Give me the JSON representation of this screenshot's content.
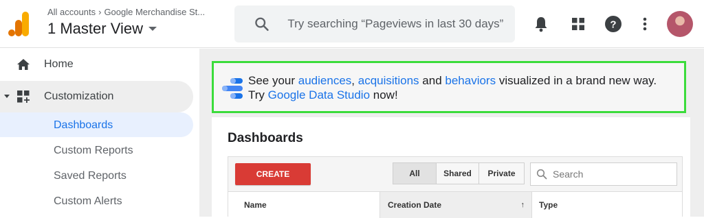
{
  "header": {
    "breadcrumb_root": "All accounts",
    "breadcrumb_property": "Google Merchandise St...",
    "view_name": "1 Master View",
    "search_placeholder": "Try searching “Pageviews in last 30 days”"
  },
  "sidebar": {
    "home_label": "Home",
    "customization_label": "Customization",
    "sub_items": [
      "Dashboards",
      "Custom Reports",
      "Saved Reports",
      "Custom Alerts"
    ],
    "active_item": "Dashboards"
  },
  "banner": {
    "prefix": "See your ",
    "link_audiences": "audiences",
    "sep1": ", ",
    "link_acquisitions": "acquisitions",
    "sep2": " and ",
    "link_behaviors": "behaviors",
    "middle": " visualized in a brand new way. Try ",
    "link_studio": "Google Data Studio",
    "suffix": " now!"
  },
  "dashboards": {
    "title": "Dashboards",
    "create_label": "CREATE",
    "filters": [
      "All",
      "Shared",
      "Private"
    ],
    "active_filter": "All",
    "search_placeholder": "Search",
    "columns": [
      "Name",
      "Creation Date",
      "Type"
    ],
    "sort_indicator": "↑"
  },
  "colors": {
    "accent": "#1a73e8",
    "create_button": "#d93b35",
    "banner_highlight": "#3bdc3b"
  },
  "icons": {
    "logo": "analytics-logo",
    "search": "search-icon",
    "bell": "bell-icon",
    "apps": "apps-grid-icon",
    "help": "help-icon",
    "more": "more-vert-icon"
  }
}
